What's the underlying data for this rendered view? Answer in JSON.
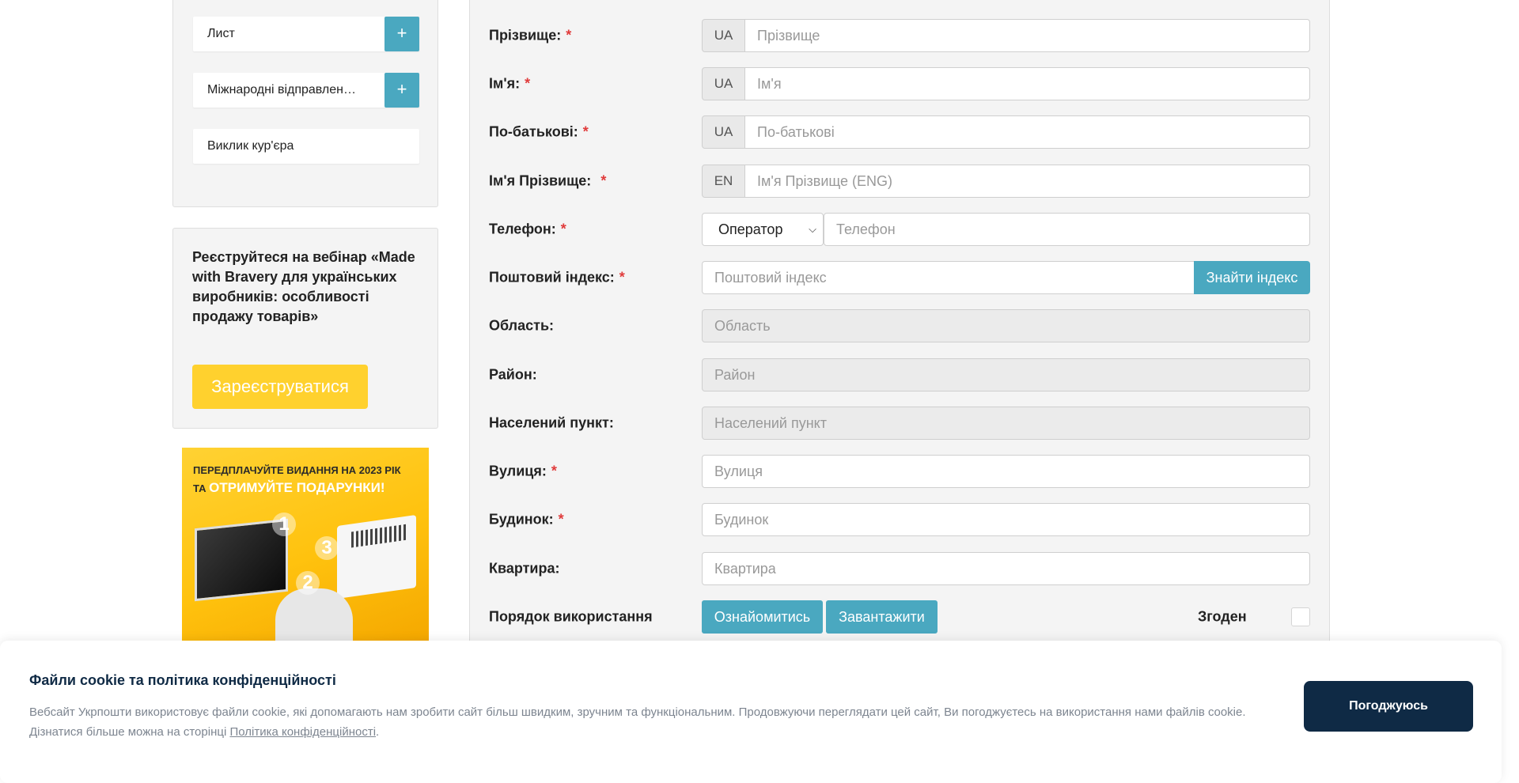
{
  "sidebar": {
    "menu": [
      {
        "label": "Лист",
        "has_plus": true
      },
      {
        "label": "Міжнародні відправлен…",
        "has_plus": true
      },
      {
        "label": "Виклик кур'єра",
        "has_plus": false
      }
    ],
    "plus_icon": "+",
    "webinar": {
      "text": "Реєструйтеся на вебінар «Made with Bravery для українських виробників: особливості продажу товарів»",
      "button": "Зареєструватися"
    },
    "promo": {
      "line1": "ПЕРЕДПЛАЧУЙТЕ ВИДАННЯ НА 2023 РІК",
      "line2_prefix": "ТА",
      "line2_highlight": "ОТРИМУЙТЕ ПОДАРУНКИ!",
      "numbers": [
        "1",
        "2",
        "3"
      ]
    }
  },
  "form": {
    "required_mark": "*",
    "surname": {
      "label": "Прізвище:",
      "lang": "UA",
      "placeholder": "Прізвище"
    },
    "first_name": {
      "label": "Ім'я:",
      "lang": "UA",
      "placeholder": "Ім'я"
    },
    "patronymic": {
      "label": "По-батькові:",
      "lang": "UA",
      "placeholder": "По-батькові"
    },
    "full_name_eng": {
      "label": "Ім'я Прізвище:",
      "lang": "EN",
      "placeholder": "Ім'я Прізвище (ENG)"
    },
    "phone": {
      "label": "Телефон:",
      "operator": "Оператор",
      "placeholder": "Телефон"
    },
    "postal": {
      "label": "Поштовий індекс:",
      "placeholder": "Поштовий індекс",
      "button": "Знайти індекс"
    },
    "region": {
      "label": "Область:",
      "placeholder": "Область"
    },
    "district": {
      "label": "Район:",
      "placeholder": "Район"
    },
    "settlement": {
      "label": "Населений пункт:",
      "placeholder": "Населений пункт"
    },
    "street": {
      "label": "Вулиця:",
      "placeholder": "Вулиця"
    },
    "house": {
      "label": "Будинок:",
      "placeholder": "Будинок"
    },
    "apartment": {
      "label": "Квартира:",
      "placeholder": "Квартира"
    },
    "terms": {
      "label": "Порядок використання",
      "view_button": "Ознайомитись",
      "download_button": "Завантажити",
      "agree_label": "Згоден"
    }
  },
  "cookie": {
    "title": "Файли cookie та політика конфіденційності",
    "text": "Вебсайт Укрпошти використовує файли cookie, які допомагають нам зробити сайт більш швидким, зручним та функціональним. Продовжуючи переглядати цей сайт, Ви погоджуєтесь на використання нами файлів cookie. Дізнатися більше можна на сторінці",
    "link": "Політика конфіденційності",
    "after_link": ".",
    "button": "Погоджуюсь"
  },
  "colors": {
    "accent_teal": "#4aa8c0",
    "accent_yellow": "#ffd12e",
    "required_red": "#e03b3b",
    "cookie_dark": "#0f2a45"
  }
}
